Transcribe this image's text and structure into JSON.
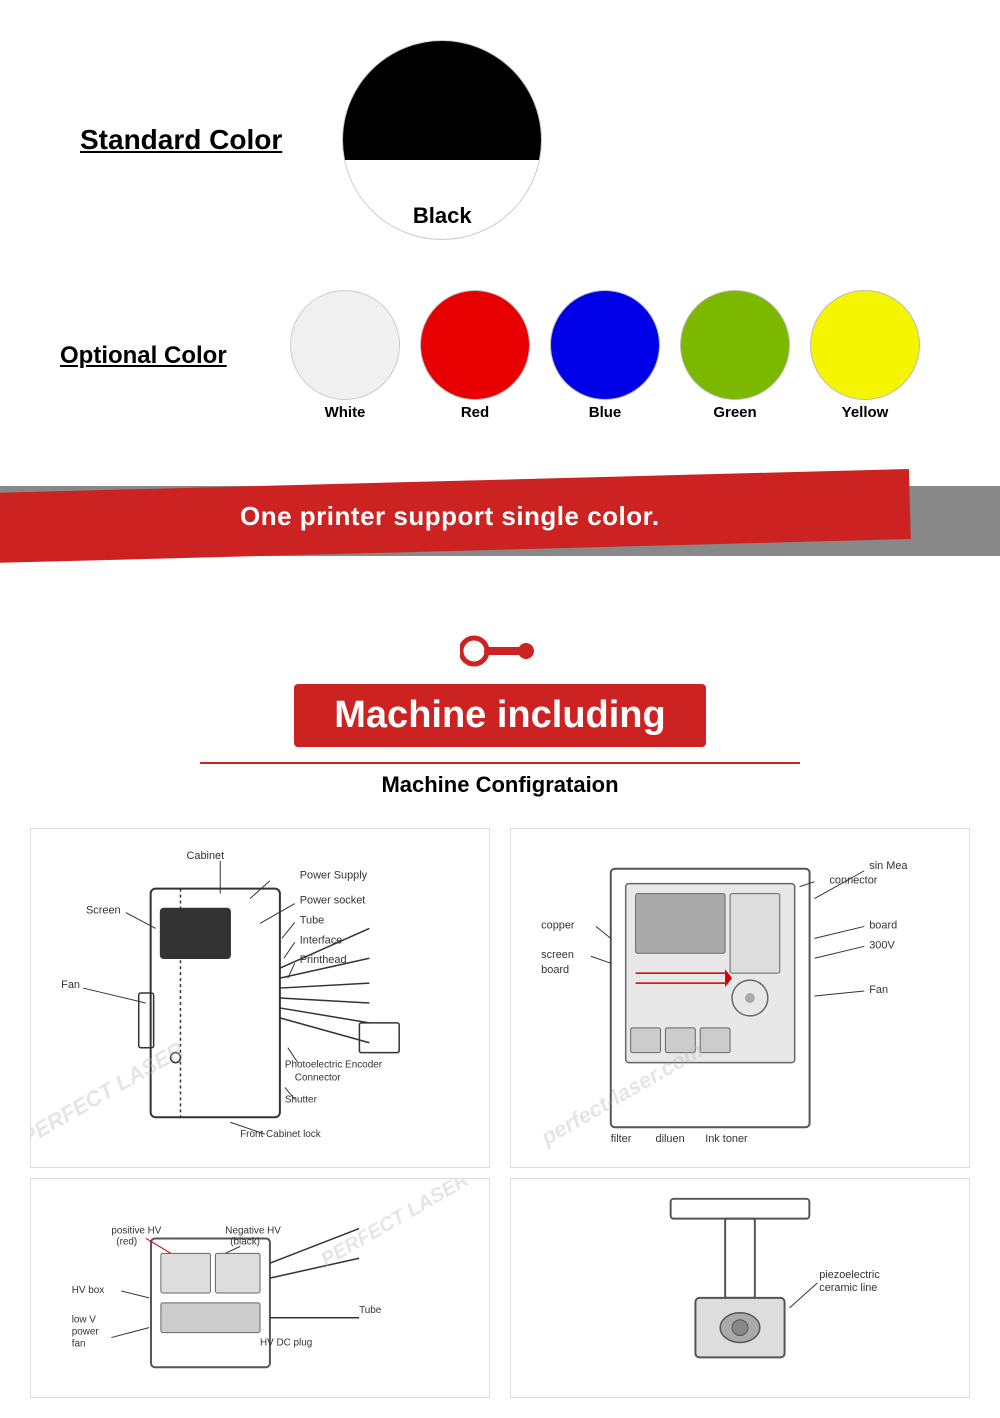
{
  "standard_color": {
    "label": "Standard Color",
    "circle_color": "Black",
    "circle_hex": "#000000"
  },
  "optional_color": {
    "label": "Optional Color",
    "colors": [
      {
        "name": "White",
        "class": "white",
        "hex": "#f0f0f0"
      },
      {
        "name": "Red",
        "class": "red",
        "hex": "#e80000"
      },
      {
        "name": "Blue",
        "class": "blue",
        "hex": "#0000e8"
      },
      {
        "name": "Green",
        "class": "green",
        "hex": "#7cb800"
      },
      {
        "name": "Yellow",
        "class": "yellow",
        "hex": "#f5f500"
      }
    ]
  },
  "banner": {
    "text": "One printer support single color."
  },
  "machine_section": {
    "badge_label": "Machine including",
    "config_title": "Machine Configrataion"
  },
  "diagrams": {
    "left_labels": [
      "Cabinet",
      "Power Supply",
      "Power socket",
      "Tube",
      "Interface",
      "Printhead",
      "Photoelectric Encoder Connector",
      "Shutter",
      "Front Cabinet lock",
      "Screen",
      "Fan"
    ],
    "right_labels": [
      "connector",
      "sin Mea",
      "copper",
      "screen board",
      "board",
      "300V",
      "Fan",
      "filter",
      "diluen",
      "Ink toner"
    ],
    "bottom_left_labels": [
      "positive HV (red)",
      "Negative HV (black)",
      "HV box",
      "low V power fan",
      "HV DC plug",
      "Tube"
    ],
    "bottom_right_labels": [
      "piezoelectric ceramic line"
    ]
  },
  "watermark": "PERFECT LASER"
}
